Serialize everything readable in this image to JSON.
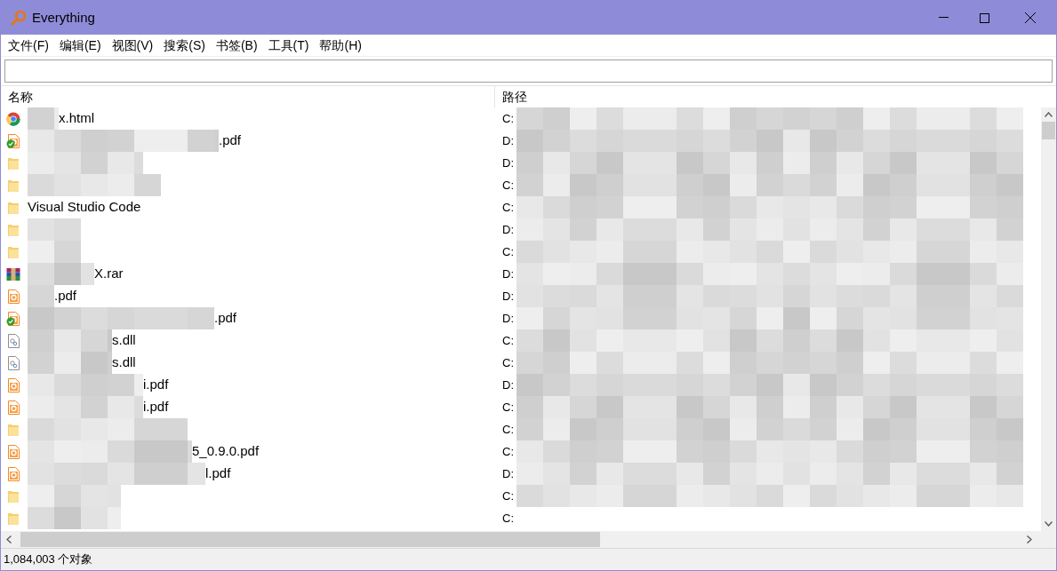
{
  "window": {
    "title": "Everything"
  },
  "menu": [
    "文件(F)",
    "编辑(E)",
    "视图(V)",
    "搜索(S)",
    "书签(B)",
    "工具(T)",
    "帮助(H)"
  ],
  "table": {
    "columns": [
      "名称",
      "路径"
    ],
    "rows": [
      {
        "kind": "html",
        "name": "x.html",
        "path": "C:"
      },
      {
        "kind": "pdf-synced",
        "name": ".pdf",
        "path": "D:"
      },
      {
        "kind": "folder",
        "path": "D:"
      },
      {
        "kind": "folder",
        "path": "C:"
      },
      {
        "kind": "folder",
        "name": "Visual Studio Code",
        "path": "C:"
      },
      {
        "kind": "folder",
        "path": "D:"
      },
      {
        "kind": "folder",
        "path": "C:"
      },
      {
        "kind": "rar",
        "name": "X.rar",
        "path": "D:"
      },
      {
        "kind": "pdf",
        "name": ".pdf",
        "path": "D:"
      },
      {
        "kind": "pdf-synced",
        "name": ".pdf",
        "path": "D:"
      },
      {
        "kind": "dll",
        "name": "s.dll",
        "path": "C:"
      },
      {
        "kind": "dll",
        "name": "s.dll",
        "path": "C:"
      },
      {
        "kind": "pdf",
        "name": "i.pdf",
        "path": "D:"
      },
      {
        "kind": "pdf",
        "name": "i.pdf",
        "path": "C:"
      },
      {
        "kind": "folder",
        "path": "C:"
      },
      {
        "kind": "pdf",
        "name": "5_0.9.0.pdf",
        "path": "C:"
      },
      {
        "kind": "pdf",
        "name": "l.pdf",
        "path": "D:"
      },
      {
        "kind": "folder",
        "path": "C:"
      },
      {
        "kind": "folder",
        "path": "C:"
      }
    ]
  },
  "status_bar": "1,084,003 个对象"
}
